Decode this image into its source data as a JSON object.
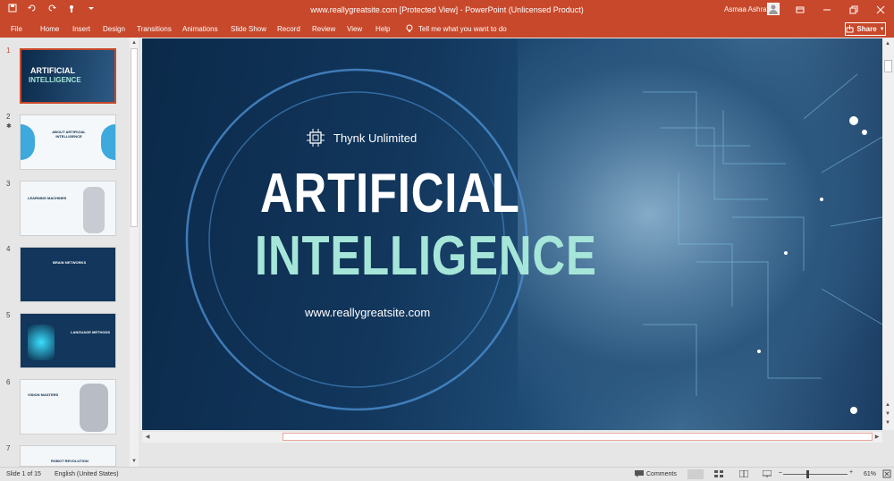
{
  "window": {
    "title": "www.reallygreatsite.com [Protected View]  -  PowerPoint (Unlicensed Product)",
    "user": "Asmaa Ashraf"
  },
  "ribbon": {
    "tabs": [
      "File",
      "Home",
      "Insert",
      "Design",
      "Transitions",
      "Animations",
      "Slide Show",
      "Record",
      "Review",
      "View",
      "Help"
    ],
    "tell_me": "Tell me what you want to do",
    "share": "Share"
  },
  "thumbnails": {
    "numbers": [
      "1",
      "2",
      "3",
      "4",
      "5",
      "6",
      "7"
    ],
    "t2_title": "ABOUT ARTIFICIAL INTELLIGENCE",
    "t3_title": "LEARNING MACHINES",
    "t4_title": "BRAIN NETWORKS",
    "t5_title": "LANGUAGE METHODS",
    "t6_title": "VISION MASTERS",
    "t7_title": "ROBOT REVOLUTION"
  },
  "slide": {
    "brand": "Thynk Unlimited",
    "title_line1": "ARTIFICIAL",
    "title_line2": "INTELLIGENCE",
    "url": "www.reallygreatsite.com"
  },
  "status": {
    "slide_counter": "Slide 1 of 15",
    "language": "English (United States)",
    "comments": "Comments",
    "zoom": "61%"
  },
  "colors": {
    "accent": "#c8482b",
    "title_teal": "#a6e6d9"
  }
}
